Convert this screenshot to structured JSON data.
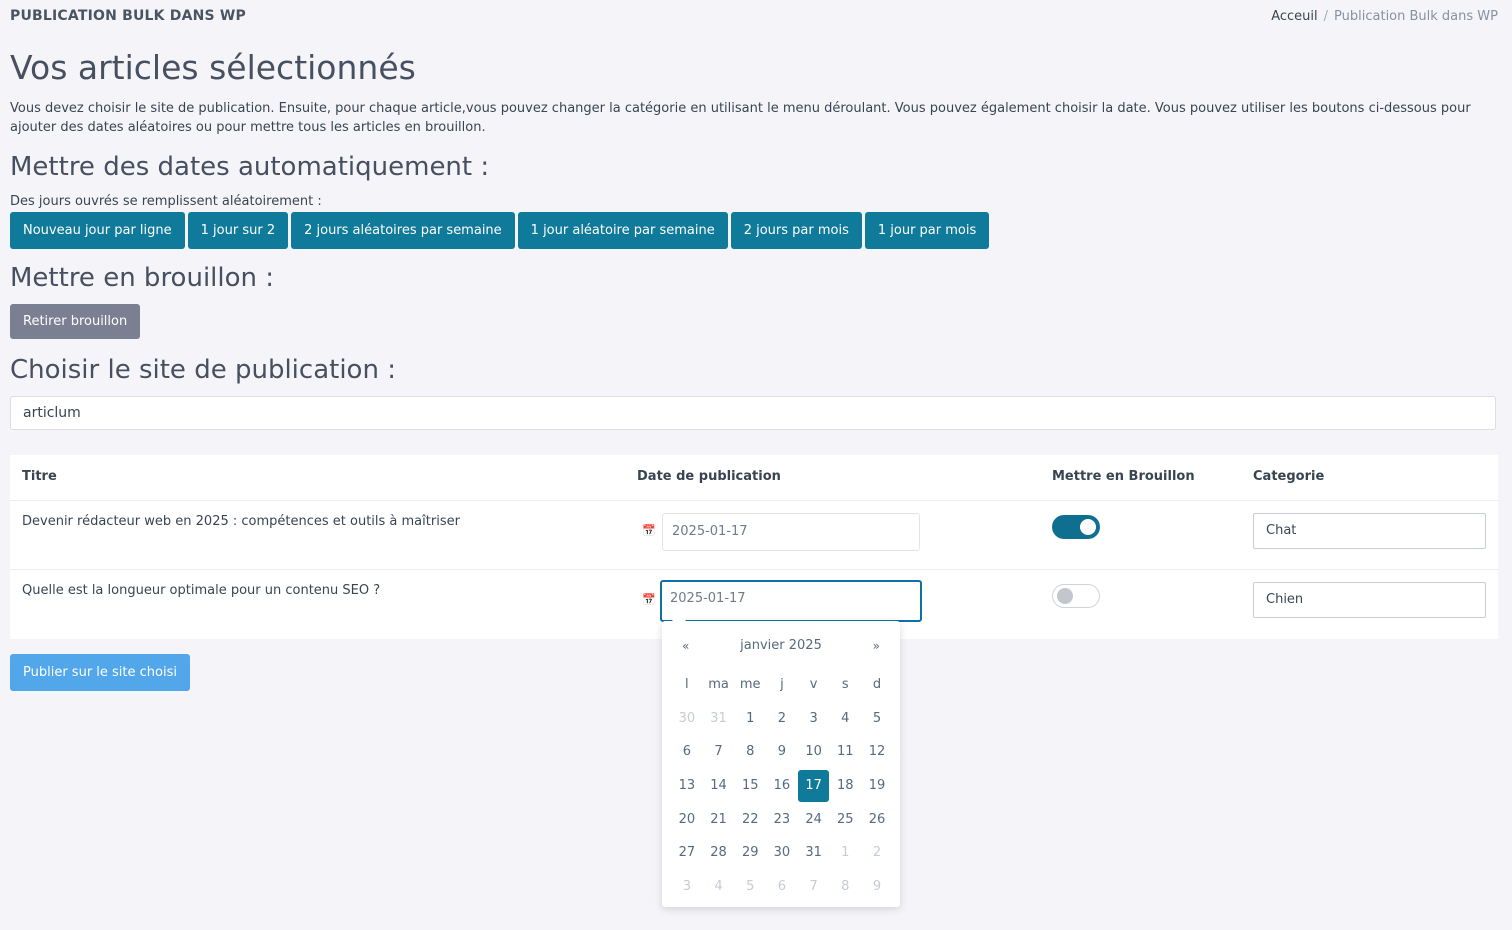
{
  "header": {
    "app_title": "PUBLICATION BULK DANS WP",
    "breadcrumb": {
      "home": "Acceuil",
      "separator": "/",
      "current": "Publication Bulk dans WP"
    }
  },
  "page_title": "Vos articles sélectionnés",
  "intro": "Vous devez choisir le site de publication. Ensuite, pour chaque article,vous pouvez changer la catégorie en utilisant le menu déroulant. Vous pouvez également choisir la date. Vous pouvez utiliser les boutons ci-dessous pour ajouter des dates aléatoires ou pour mettre tous les articles en brouillon.",
  "auto_dates": {
    "heading": "Mettre des dates automatiquement :",
    "hint": "Des jours ouvrés se remplissent aléatoirement :",
    "buttons": [
      "Nouveau jour par ligne",
      "1 jour sur 2",
      "2 jours aléatoires par semaine",
      "1 jour aléatoire par semaine",
      "2 jours par mois",
      "1 jour par mois"
    ]
  },
  "draft": {
    "heading": "Mettre en brouillon :",
    "button": "Retirer brouillon"
  },
  "site": {
    "heading": "Choisir le site de publication :",
    "selected": "articlum"
  },
  "table": {
    "headers": [
      "Titre",
      "Date de publication",
      "Mettre en Brouillon",
      "Categorie"
    ],
    "rows": [
      {
        "title": "Devenir rédacteur web en 2025 : compétences et outils à maîtriser",
        "date": "2025-01-17",
        "draft": true,
        "category": "Chat"
      },
      {
        "title": "Quelle est la longueur optimale pour un contenu SEO ?",
        "date": "2025-01-17",
        "draft": false,
        "category": "Chien"
      }
    ]
  },
  "publish_button": "Publier sur le site choisi",
  "datepicker": {
    "prev": "«",
    "next": "»",
    "month": "janvier 2025",
    "weekdays": [
      "l",
      "ma",
      "me",
      "j",
      "v",
      "s",
      "d"
    ],
    "weeks": [
      [
        "30",
        "31",
        "1",
        "2",
        "3",
        "4",
        "5"
      ],
      [
        "6",
        "7",
        "8",
        "9",
        "10",
        "11",
        "12"
      ],
      [
        "13",
        "14",
        "15",
        "16",
        "17",
        "18",
        "19"
      ],
      [
        "20",
        "21",
        "22",
        "23",
        "24",
        "25",
        "26"
      ],
      [
        "27",
        "28",
        "29",
        "30",
        "31",
        "1",
        "2"
      ],
      [
        "3",
        "4",
        "5",
        "6",
        "7",
        "8",
        "9"
      ]
    ],
    "selected_day": "17"
  },
  "colors": {
    "primary": "#0f7a99",
    "secondary": "#7b7f92",
    "publish": "#52a7ea",
    "toggle_on": "#0f6f90"
  },
  "icons": {
    "calendar": "calendar-icon"
  }
}
